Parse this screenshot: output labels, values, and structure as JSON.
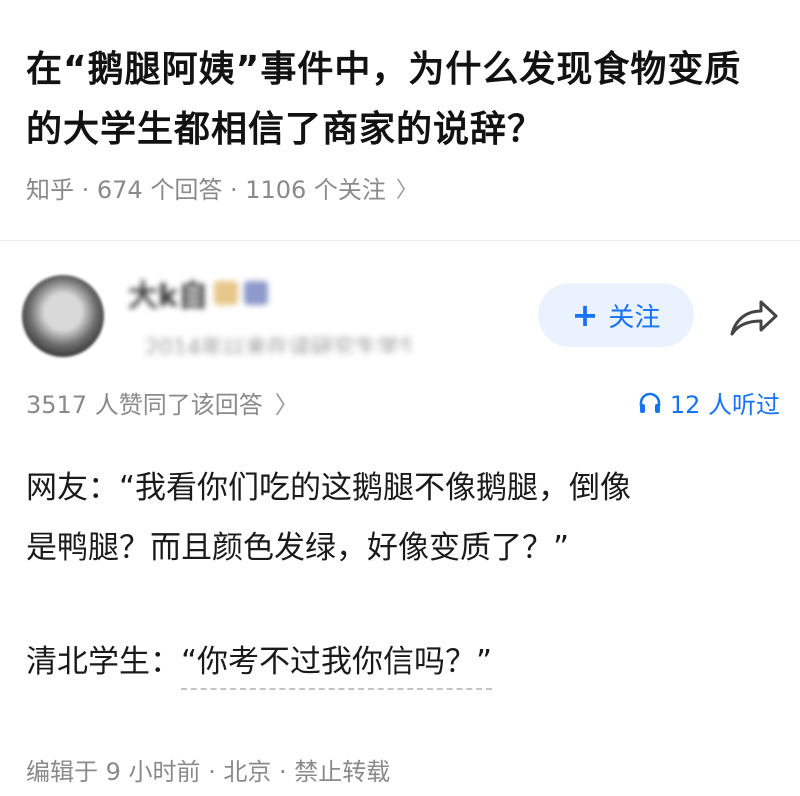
{
  "question": {
    "title": "在“鹅腿阿姨”事件中，为什么发现食物变质的大学生都相信了商家的说辞？",
    "meta": "知乎 · 674 个回答 · 1106 个关注",
    "chevron": "〉"
  },
  "author": {
    "name": "大k自",
    "bio": "2014年以来在读研究生学生",
    "follow_label": "关注",
    "follow_icon": "plus-icon",
    "share_icon": "share-arrow-icon"
  },
  "stats": {
    "votes": "3517 人赞同了该回答",
    "chevron": "〉",
    "listened": "12 人听过",
    "listened_icon": "headphones-icon"
  },
  "answer": {
    "line1": "网友：“我看你们吃的这鹅腿不像鹅腿，倒像",
    "line2": "是鸭腿？而且颜色发绿，好像变质了？”",
    "line3_speaker": "清北学生：",
    "line3_quote": "“你考不过我你信吗？”"
  },
  "footer": {
    "edited": "编辑于 9 小时前 · 北京 · 禁止转载"
  },
  "colors": {
    "accent": "#1772f6",
    "follow_bg": "#eaf3fd",
    "meta_gray": "#8a8a8a"
  }
}
